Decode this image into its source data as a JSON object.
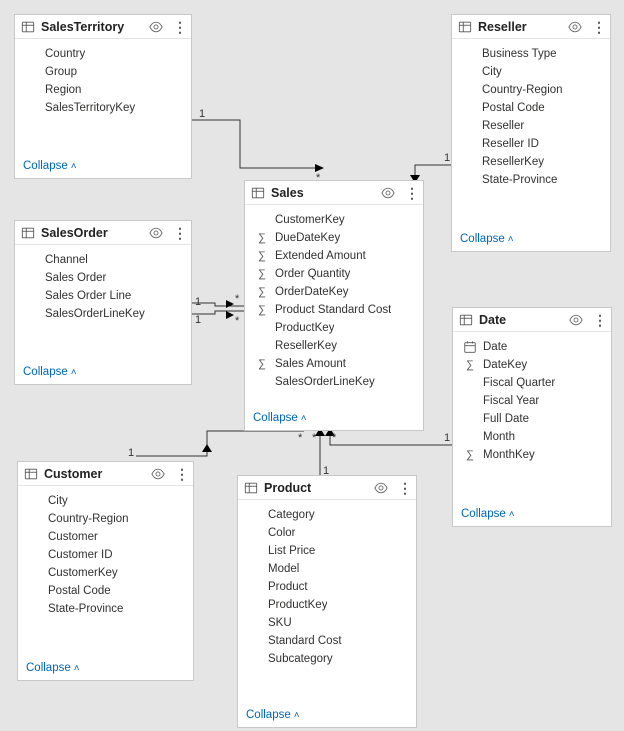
{
  "collapseLabel": "Collapse",
  "cardinality": {
    "one": "1",
    "many": "*"
  },
  "tables": {
    "salesTerritory": {
      "title": "SalesTerritory",
      "fields": [
        {
          "label": "Country",
          "icon": ""
        },
        {
          "label": "Group",
          "icon": ""
        },
        {
          "label": "Region",
          "icon": ""
        },
        {
          "label": "SalesTerritoryKey",
          "icon": ""
        }
      ]
    },
    "reseller": {
      "title": "Reseller",
      "fields": [
        {
          "label": "Business Type",
          "icon": ""
        },
        {
          "label": "City",
          "icon": ""
        },
        {
          "label": "Country-Region",
          "icon": ""
        },
        {
          "label": "Postal Code",
          "icon": ""
        },
        {
          "label": "Reseller",
          "icon": ""
        },
        {
          "label": "Reseller ID",
          "icon": ""
        },
        {
          "label": "ResellerKey",
          "icon": ""
        },
        {
          "label": "State-Province",
          "icon": ""
        }
      ]
    },
    "salesOrder": {
      "title": "SalesOrder",
      "fields": [
        {
          "label": "Channel",
          "icon": ""
        },
        {
          "label": "Sales Order",
          "icon": ""
        },
        {
          "label": "Sales Order Line",
          "icon": ""
        },
        {
          "label": "SalesOrderLineKey",
          "icon": ""
        }
      ]
    },
    "sales": {
      "title": "Sales",
      "fields": [
        {
          "label": "CustomerKey",
          "icon": ""
        },
        {
          "label": "DueDateKey",
          "icon": "sigma"
        },
        {
          "label": "Extended Amount",
          "icon": "sigma"
        },
        {
          "label": "Order Quantity",
          "icon": "sigma"
        },
        {
          "label": "OrderDateKey",
          "icon": "sigma"
        },
        {
          "label": "Product Standard Cost",
          "icon": "sigma"
        },
        {
          "label": "ProductKey",
          "icon": ""
        },
        {
          "label": "ResellerKey",
          "icon": ""
        },
        {
          "label": "Sales Amount",
          "icon": "sigma"
        },
        {
          "label": "SalesOrderLineKey",
          "icon": ""
        }
      ]
    },
    "date": {
      "title": "Date",
      "fields": [
        {
          "label": "Date",
          "icon": "calendar"
        },
        {
          "label": "DateKey",
          "icon": "sigma"
        },
        {
          "label": "Fiscal Quarter",
          "icon": ""
        },
        {
          "label": "Fiscal Year",
          "icon": ""
        },
        {
          "label": "Full Date",
          "icon": ""
        },
        {
          "label": "Month",
          "icon": ""
        },
        {
          "label": "MonthKey",
          "icon": "sigma"
        }
      ]
    },
    "customer": {
      "title": "Customer",
      "fields": [
        {
          "label": "City",
          "icon": ""
        },
        {
          "label": "Country-Region",
          "icon": ""
        },
        {
          "label": "Customer",
          "icon": ""
        },
        {
          "label": "Customer ID",
          "icon": ""
        },
        {
          "label": "CustomerKey",
          "icon": ""
        },
        {
          "label": "Postal Code",
          "icon": ""
        },
        {
          "label": "State-Province",
          "icon": ""
        }
      ]
    },
    "product": {
      "title": "Product",
      "fields": [
        {
          "label": "Category",
          "icon": ""
        },
        {
          "label": "Color",
          "icon": ""
        },
        {
          "label": "List Price",
          "icon": ""
        },
        {
          "label": "Model",
          "icon": ""
        },
        {
          "label": "Product",
          "icon": ""
        },
        {
          "label": "ProductKey",
          "icon": ""
        },
        {
          "label": "SKU",
          "icon": ""
        },
        {
          "label": "Standard Cost",
          "icon": ""
        },
        {
          "label": "Subcategory",
          "icon": ""
        }
      ]
    }
  },
  "relationships": [
    {
      "from": "salesTerritory",
      "to": "sales",
      "fromCard": "1",
      "toCard": "*"
    },
    {
      "from": "reseller",
      "to": "sales",
      "fromCard": "1",
      "toCard": "*"
    },
    {
      "from": "salesOrder",
      "to": "sales",
      "fromCard": "1",
      "toCard": "*"
    },
    {
      "from": "customer",
      "to": "sales",
      "fromCard": "1",
      "toCard": "*"
    },
    {
      "from": "date",
      "to": "sales",
      "fromCard": "1",
      "toCard": "*"
    },
    {
      "from": "product",
      "to": "sales",
      "fromCard": "1",
      "toCard": "*"
    }
  ]
}
